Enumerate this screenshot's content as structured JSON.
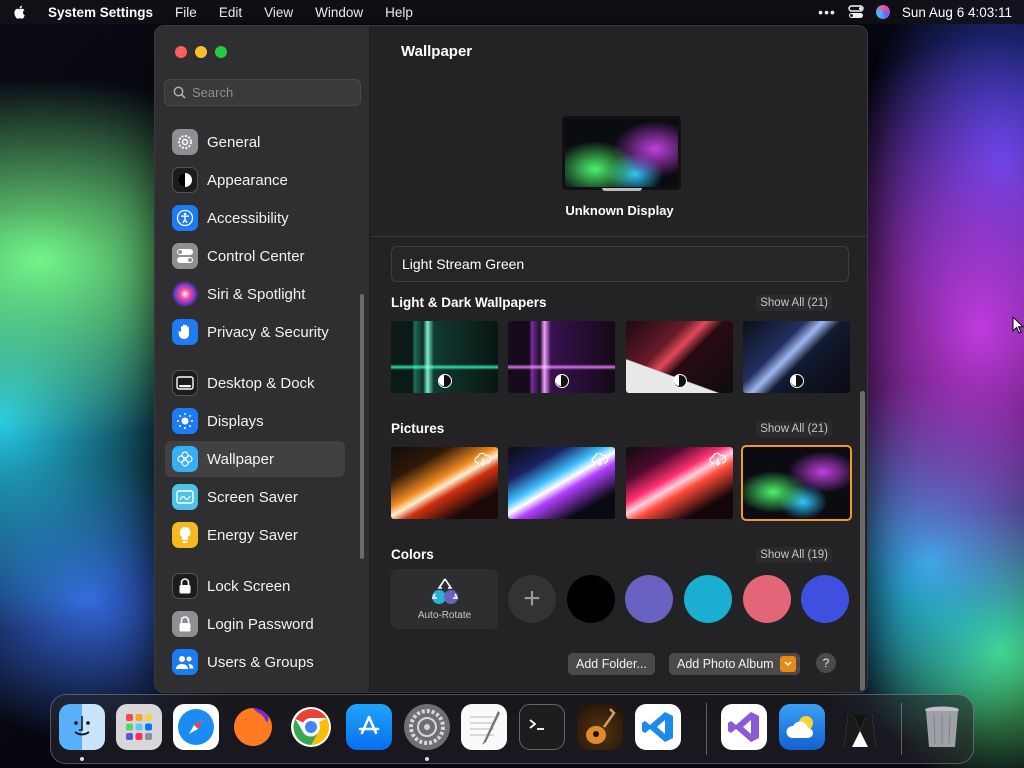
{
  "menubar": {
    "app_name": "System Settings",
    "menus": [
      "File",
      "Edit",
      "View",
      "Window",
      "Help"
    ],
    "clock": "Sun Aug 6  4:03:11"
  },
  "search": {
    "placeholder": "Search"
  },
  "sidebar": {
    "items": [
      {
        "label": "General",
        "icon": "gear-icon",
        "color": "#8e8e93"
      },
      {
        "label": "Appearance",
        "icon": "appearance-icon",
        "color": "#1c1c1e"
      },
      {
        "label": "Accessibility",
        "icon": "accessibility-icon",
        "color": "#1e7cf2"
      },
      {
        "label": "Control Center",
        "icon": "toggle-icon",
        "color": "#8e8e93"
      },
      {
        "label": "Siri & Spotlight",
        "icon": "siri-icon",
        "color": "#6a3dc4"
      },
      {
        "label": "Privacy & Security",
        "icon": "hand-icon",
        "color": "#1e7cf2"
      },
      {
        "label": "Desktop & Dock",
        "icon": "dock-icon",
        "color": "#1c1c1e"
      },
      {
        "label": "Displays",
        "icon": "sun-icon",
        "color": "#1e7cf2"
      },
      {
        "label": "Wallpaper",
        "icon": "flower-icon",
        "color": "#37aef5",
        "selected": true
      },
      {
        "label": "Screen Saver",
        "icon": "screensaver-icon",
        "color": "#4cc4e8"
      },
      {
        "label": "Energy Saver",
        "icon": "bulb-icon",
        "color": "#f5b921"
      },
      {
        "label": "Lock Screen",
        "icon": "lock-icon",
        "color": "#1c1c1e"
      },
      {
        "label": "Login Password",
        "icon": "lock-icon",
        "color": "#8e8e93"
      },
      {
        "label": "Users & Groups",
        "icon": "users-icon",
        "color": "#1e7cf2"
      }
    ]
  },
  "main": {
    "title": "Wallpaper",
    "display_name": "Unknown Display",
    "wallpaper_name": "Light Stream Green",
    "sections": [
      {
        "title": "Light & Dark Wallpapers",
        "show_all": "Show All (21)"
      },
      {
        "title": "Pictures",
        "show_all": "Show All (21)"
      },
      {
        "title": "Colors",
        "show_all": "Show All (19)"
      }
    ],
    "auto_rotate_label": "Auto-Rotate",
    "colors": [
      "#000000",
      "#6a62c0",
      "#1aaed0",
      "#e26677",
      "#3f50e0"
    ],
    "add_folder": "Add Folder...",
    "add_photo_album": "Add Photo Album",
    "help": "?"
  },
  "accent": "#f09a1f"
}
